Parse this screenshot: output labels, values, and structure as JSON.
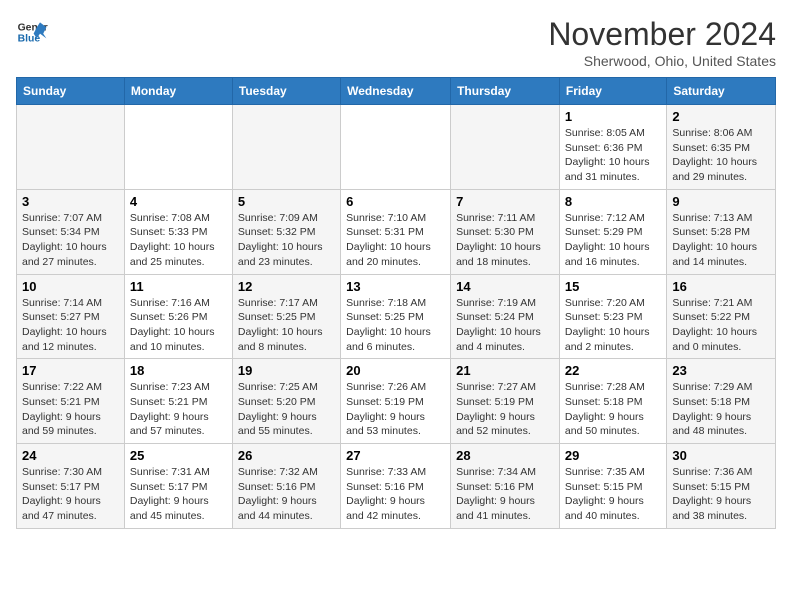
{
  "header": {
    "logo_line1": "General",
    "logo_line2": "Blue",
    "month": "November 2024",
    "location": "Sherwood, Ohio, United States"
  },
  "weekdays": [
    "Sunday",
    "Monday",
    "Tuesday",
    "Wednesday",
    "Thursday",
    "Friday",
    "Saturday"
  ],
  "weeks": [
    [
      {
        "day": "",
        "info": ""
      },
      {
        "day": "",
        "info": ""
      },
      {
        "day": "",
        "info": ""
      },
      {
        "day": "",
        "info": ""
      },
      {
        "day": "",
        "info": ""
      },
      {
        "day": "1",
        "info": "Sunrise: 8:05 AM\nSunset: 6:36 PM\nDaylight: 10 hours\nand 31 minutes."
      },
      {
        "day": "2",
        "info": "Sunrise: 8:06 AM\nSunset: 6:35 PM\nDaylight: 10 hours\nand 29 minutes."
      }
    ],
    [
      {
        "day": "3",
        "info": "Sunrise: 7:07 AM\nSunset: 5:34 PM\nDaylight: 10 hours\nand 27 minutes."
      },
      {
        "day": "4",
        "info": "Sunrise: 7:08 AM\nSunset: 5:33 PM\nDaylight: 10 hours\nand 25 minutes."
      },
      {
        "day": "5",
        "info": "Sunrise: 7:09 AM\nSunset: 5:32 PM\nDaylight: 10 hours\nand 23 minutes."
      },
      {
        "day": "6",
        "info": "Sunrise: 7:10 AM\nSunset: 5:31 PM\nDaylight: 10 hours\nand 20 minutes."
      },
      {
        "day": "7",
        "info": "Sunrise: 7:11 AM\nSunset: 5:30 PM\nDaylight: 10 hours\nand 18 minutes."
      },
      {
        "day": "8",
        "info": "Sunrise: 7:12 AM\nSunset: 5:29 PM\nDaylight: 10 hours\nand 16 minutes."
      },
      {
        "day": "9",
        "info": "Sunrise: 7:13 AM\nSunset: 5:28 PM\nDaylight: 10 hours\nand 14 minutes."
      }
    ],
    [
      {
        "day": "10",
        "info": "Sunrise: 7:14 AM\nSunset: 5:27 PM\nDaylight: 10 hours\nand 12 minutes."
      },
      {
        "day": "11",
        "info": "Sunrise: 7:16 AM\nSunset: 5:26 PM\nDaylight: 10 hours\nand 10 minutes."
      },
      {
        "day": "12",
        "info": "Sunrise: 7:17 AM\nSunset: 5:25 PM\nDaylight: 10 hours\nand 8 minutes."
      },
      {
        "day": "13",
        "info": "Sunrise: 7:18 AM\nSunset: 5:25 PM\nDaylight: 10 hours\nand 6 minutes."
      },
      {
        "day": "14",
        "info": "Sunrise: 7:19 AM\nSunset: 5:24 PM\nDaylight: 10 hours\nand 4 minutes."
      },
      {
        "day": "15",
        "info": "Sunrise: 7:20 AM\nSunset: 5:23 PM\nDaylight: 10 hours\nand 2 minutes."
      },
      {
        "day": "16",
        "info": "Sunrise: 7:21 AM\nSunset: 5:22 PM\nDaylight: 10 hours\nand 0 minutes."
      }
    ],
    [
      {
        "day": "17",
        "info": "Sunrise: 7:22 AM\nSunset: 5:21 PM\nDaylight: 9 hours\nand 59 minutes."
      },
      {
        "day": "18",
        "info": "Sunrise: 7:23 AM\nSunset: 5:21 PM\nDaylight: 9 hours\nand 57 minutes."
      },
      {
        "day": "19",
        "info": "Sunrise: 7:25 AM\nSunset: 5:20 PM\nDaylight: 9 hours\nand 55 minutes."
      },
      {
        "day": "20",
        "info": "Sunrise: 7:26 AM\nSunset: 5:19 PM\nDaylight: 9 hours\nand 53 minutes."
      },
      {
        "day": "21",
        "info": "Sunrise: 7:27 AM\nSunset: 5:19 PM\nDaylight: 9 hours\nand 52 minutes."
      },
      {
        "day": "22",
        "info": "Sunrise: 7:28 AM\nSunset: 5:18 PM\nDaylight: 9 hours\nand 50 minutes."
      },
      {
        "day": "23",
        "info": "Sunrise: 7:29 AM\nSunset: 5:18 PM\nDaylight: 9 hours\nand 48 minutes."
      }
    ],
    [
      {
        "day": "24",
        "info": "Sunrise: 7:30 AM\nSunset: 5:17 PM\nDaylight: 9 hours\nand 47 minutes."
      },
      {
        "day": "25",
        "info": "Sunrise: 7:31 AM\nSunset: 5:17 PM\nDaylight: 9 hours\nand 45 minutes."
      },
      {
        "day": "26",
        "info": "Sunrise: 7:32 AM\nSunset: 5:16 PM\nDaylight: 9 hours\nand 44 minutes."
      },
      {
        "day": "27",
        "info": "Sunrise: 7:33 AM\nSunset: 5:16 PM\nDaylight: 9 hours\nand 42 minutes."
      },
      {
        "day": "28",
        "info": "Sunrise: 7:34 AM\nSunset: 5:16 PM\nDaylight: 9 hours\nand 41 minutes."
      },
      {
        "day": "29",
        "info": "Sunrise: 7:35 AM\nSunset: 5:15 PM\nDaylight: 9 hours\nand 40 minutes."
      },
      {
        "day": "30",
        "info": "Sunrise: 7:36 AM\nSunset: 5:15 PM\nDaylight: 9 hours\nand 38 minutes."
      }
    ]
  ]
}
